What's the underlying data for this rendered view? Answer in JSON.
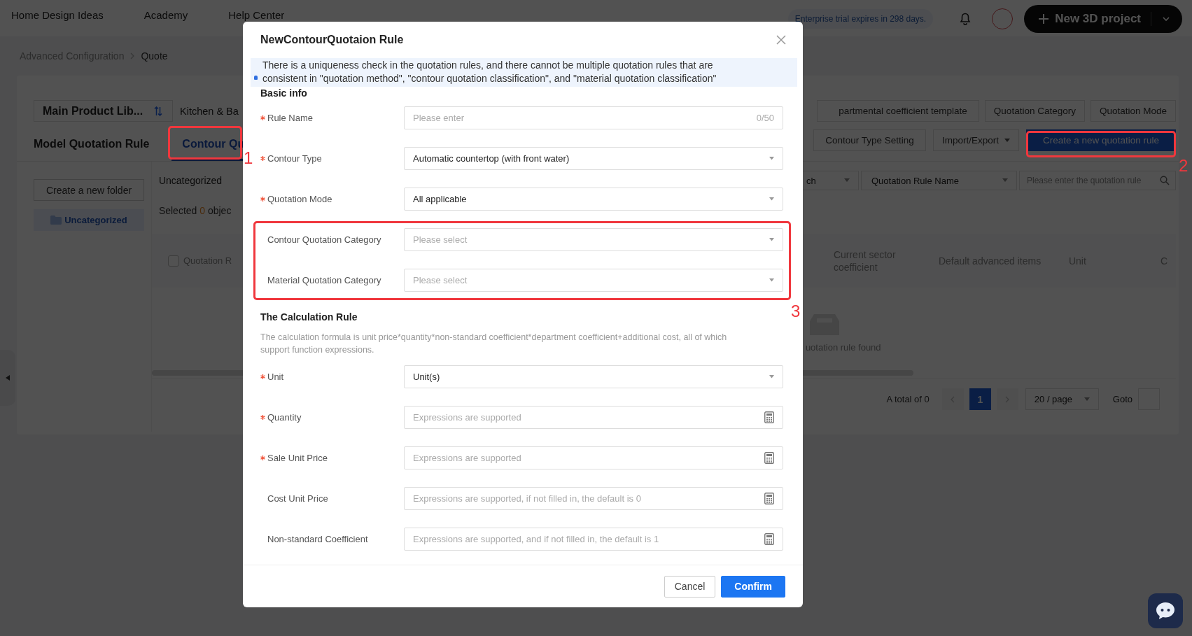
{
  "top_nav": {
    "links": [
      "Home Design Ideas",
      "Academy",
      "Help Center"
    ],
    "trial_notice": "Enterprise trial expires in 298 days.",
    "new_project_button": "New 3D project"
  },
  "breadcrumb": [
    "Advanced Configuration",
    "Quote"
  ],
  "library_selector": "Main Product Lib...",
  "category_label": "Kitchen & Ba",
  "toolbar_buttons": [
    {
      "label": "partmental coefficient template"
    },
    {
      "label": "Quotation Category"
    },
    {
      "label": "Quotation Mode"
    }
  ],
  "tabs": [
    {
      "label": "Model Quotation Rule",
      "selected": false
    },
    {
      "label": "Contour Qu",
      "selected": true
    }
  ],
  "action_buttons": [
    {
      "label": "Contour Type Setting",
      "kind": "plain"
    },
    {
      "label": "Import/Export",
      "kind": "dropdown"
    },
    {
      "label": "Create a new quotation rule",
      "kind": "primary"
    }
  ],
  "sidebar": {
    "button": "Create a new folder",
    "folders": [
      {
        "label": "Uncategorized",
        "selected": true
      }
    ]
  },
  "content": {
    "title": "Uncategorized",
    "selection": {
      "prefix": "Selected",
      "count": "0",
      "suffix": "objec"
    },
    "filters": [
      {
        "kind": "select",
        "value": "ch"
      },
      {
        "kind": "select",
        "value": "Quotation Rule Name"
      },
      {
        "kind": "search",
        "placeholder": "Please enter the quotation rule"
      }
    ],
    "table": {
      "columns": [
        {
          "label": "Quotation R",
          "kind": "checkbox",
          "checked": false
        },
        {
          "label": "Current sector coefficient",
          "kind": "text"
        },
        {
          "label": "Default advanced items",
          "kind": "text"
        },
        {
          "label": "Unit",
          "kind": "text"
        },
        {
          "label": "C",
          "kind": "text"
        }
      ]
    },
    "empty_text": "uotation rule found"
  },
  "pagination": {
    "total": "A total of 0",
    "pages": [
      {
        "label": "1",
        "selected": true
      }
    ],
    "page_size": "20 / page",
    "goto_label": "Goto"
  },
  "modal": {
    "title": "NewContourQuotaion Rule",
    "notice": "There is a uniqueness check in the quotation rules, and there cannot be multiple quotation rules that are consistent in \"quotation method\", \"contour quotation classification\", and \"material quotation classification\"",
    "sections": [
      {
        "title": "Basic info",
        "fields": [
          {
            "label": "Rule Name",
            "required": true,
            "kind": "text",
            "placeholder": "Please enter",
            "counter": "0/50"
          },
          {
            "label": "Contour Type",
            "required": true,
            "kind": "select",
            "value": "Automatic countertop (with front water)"
          },
          {
            "label": "Quotation Mode",
            "required": true,
            "kind": "select",
            "value": "All applicable"
          },
          {
            "label": "Contour Quotation Category",
            "required": false,
            "kind": "select",
            "placeholder": "Please select"
          },
          {
            "label": "Material Quotation Category",
            "required": false,
            "kind": "select",
            "placeholder": "Please select"
          }
        ]
      },
      {
        "title": "The Calculation Rule",
        "description": "The calculation formula is unit price*quantity*non-standard coefficient*department coefficient+additional cost, all of which support function expressions.",
        "fields": [
          {
            "label": "Unit",
            "required": true,
            "kind": "select",
            "value": "Unit(s)"
          },
          {
            "label": "Quantity",
            "required": true,
            "kind": "expression",
            "placeholder": "Expressions are supported"
          },
          {
            "label": "Sale Unit Price",
            "required": true,
            "kind": "expression",
            "placeholder": "Expressions are supported"
          },
          {
            "label": "Cost Unit Price",
            "required": false,
            "kind": "expression",
            "placeholder": "Expressions are supported, if not filled in, the default is 0"
          },
          {
            "label": "Non-standard Coefficient",
            "required": false,
            "kind": "expression",
            "placeholder": "Expressions are supported, and if not filled in, the default is 1"
          }
        ]
      }
    ],
    "buttons": [
      {
        "label": "Cancel",
        "kind": "secondary"
      },
      {
        "label": "Confirm",
        "kind": "primary"
      }
    ]
  },
  "annotations": [
    {
      "label": "1"
    },
    {
      "label": "2"
    },
    {
      "label": "3"
    }
  ]
}
